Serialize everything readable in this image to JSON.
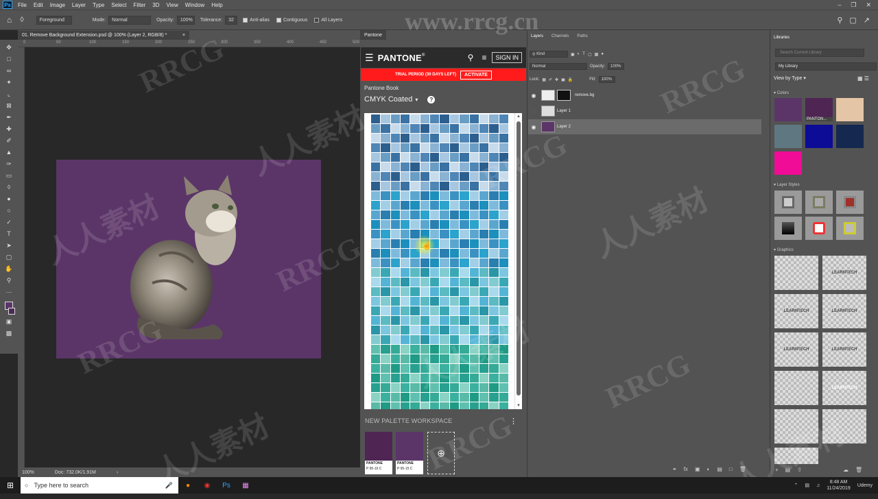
{
  "menubar": {
    "app_icon": "Ps",
    "items": [
      "File",
      "Edit",
      "Image",
      "Layer",
      "Type",
      "Select",
      "Filter",
      "3D",
      "View",
      "Window",
      "Help"
    ]
  },
  "options": {
    "preset": "Foreground",
    "mode_label": "Mode:",
    "mode_value": "Normal",
    "opacity_label": "Opacity:",
    "opacity_value": "100%",
    "tolerance_label": "Tolerance:",
    "tolerance_value": "32",
    "antialias": "Anti-alias",
    "contiguous": "Contiguous",
    "all_layers": "All Layers"
  },
  "document": {
    "tab_title": "01. Remove Background Extension.psd @ 100% (Layer 2, RGB/8) *",
    "zoom": "100%",
    "doc_size": "Doc: 732.0K/1.91M",
    "ruler_ticks": [
      "0",
      "50",
      "100",
      "150",
      "200",
      "250",
      "300",
      "350",
      "400",
      "450",
      "500"
    ]
  },
  "pantone": {
    "panel_tab": "Pantone",
    "brand": "PANTONE",
    "sign_in": "SIGN IN",
    "trial": "TRIAL PERIOD (30 DAYS LEFT)",
    "activate": "ACTIVATE",
    "book_label": "Pantone Book",
    "book_value": "CMYK Coated",
    "workspace_title": "NEW PALETTE WORKSPACE",
    "palette": [
      {
        "color": "#4e2553",
        "name": "PANTONE",
        "code": "P 95-16 C"
      },
      {
        "color": "#5b3568",
        "name": "PANTONE",
        "code": "P 95-15 C"
      }
    ],
    "swatch_colors": [
      "#2d5f8e",
      "#3a72a3",
      "#4f86b5",
      "#6a9dc4",
      "#89b2d3",
      "#a7c6e0",
      "#c7dbeb",
      "#2a7fb0",
      "#3b92c2",
      "#5ba6cf",
      "#7ebadb",
      "#a2cee6",
      "#1c8fbd",
      "#2ba3cc",
      "#53b4d6",
      "#7cc6e0",
      "#a9d9ec",
      "#2a96a8",
      "#3aa8b4",
      "#5bbac2",
      "#82cbd0",
      "#28a090",
      "#3bb09f",
      "#60c0b0",
      "#8ad2c4",
      "#1f9a85",
      "#35aa96",
      "#5abaa8"
    ]
  },
  "layers": {
    "tabs": [
      "Layers",
      "Channels",
      "Paths"
    ],
    "kind": "Kind",
    "blend": "Normal",
    "opacity_label": "Opacity:",
    "opacity_value": "100%",
    "lock_label": "Lock:",
    "fill_label": "Fill:",
    "fill_value": "100%",
    "items": [
      {
        "name": "remove.bg",
        "visible": true,
        "active": false
      },
      {
        "name": "Layer 1",
        "visible": false,
        "active": false
      },
      {
        "name": "Layer 2",
        "visible": true,
        "active": true
      }
    ]
  },
  "libraries": {
    "tab": "Libraries",
    "search_placeholder": "Search Current Library",
    "library": "My Library",
    "view_by": "View by Type",
    "colors_label": "Colors",
    "colors": [
      "#5b3568",
      "#4e2553",
      "#e4c6a6",
      "#5f7780",
      "#0c0c96",
      "#142850",
      "#f00c96"
    ],
    "color_caption": "PANTON...",
    "styles_label": "Layer Styles",
    "graphics_label": "Graphics",
    "graphic_text": "LEARNTECH"
  },
  "taskbar": {
    "search": "Type here to search",
    "time": "8:48 AM",
    "date": "11/24/2019",
    "tray_label": "Udemy"
  },
  "watermark": {
    "latin": "RRCG",
    "cjk": "人人素材",
    "url": "www.rrcg.cn"
  }
}
